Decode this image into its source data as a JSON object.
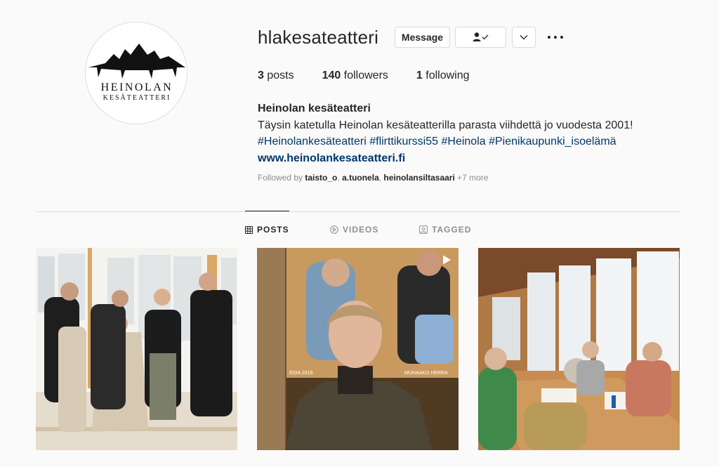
{
  "profile": {
    "username": "hlakesateatteri",
    "avatar_logo": {
      "line1": "HEINOLAN",
      "line2": "KESÄTEATTERI"
    }
  },
  "actions": {
    "message_label": "Message",
    "following_icon": "person-check-icon",
    "dropdown_icon": "chevron-down-icon",
    "more_icon": "ellipsis-icon"
  },
  "stats": {
    "posts_count": "3",
    "posts_label": "posts",
    "followers_count": "140",
    "followers_label": "followers",
    "following_count": "1",
    "following_label": "following"
  },
  "bio": {
    "full_name": "Heinolan kesäteatteri",
    "description": "Täysin katetulla Heinolan kesäteatterilla parasta viihdettä jo vuodesta 2001!",
    "hashtags": [
      "#Heinolankesäteatteri",
      "#flirttikurssi55",
      "#Heinola",
      "#Pienikaupunki_isoelämä"
    ],
    "website": "www.heinolankesateatteri.fi"
  },
  "followed_by": {
    "prefix": "Followed by",
    "users": [
      "taisto_o",
      "a.tuonela",
      "heinolansiltasaari"
    ],
    "more": "+7 more"
  },
  "tabs": [
    {
      "label": "POSTS",
      "icon": "grid-icon",
      "active": true
    },
    {
      "label": "VIDEOS",
      "icon": "play-circle-icon",
      "active": false
    },
    {
      "label": "TAGGED",
      "icon": "tag-portrait-icon",
      "active": false
    }
  ],
  "posts": {
    "post2_badge_icon": "play-icon",
    "post2_poster_caption_left": "EDIA 2018",
    "post2_poster_caption_right": "MUNAAKO HERRA"
  },
  "colors": {
    "link": "#00376b",
    "text": "#262626",
    "muted": "#8e8e8e",
    "border": "#dbdbdb",
    "background": "#fafafa"
  }
}
